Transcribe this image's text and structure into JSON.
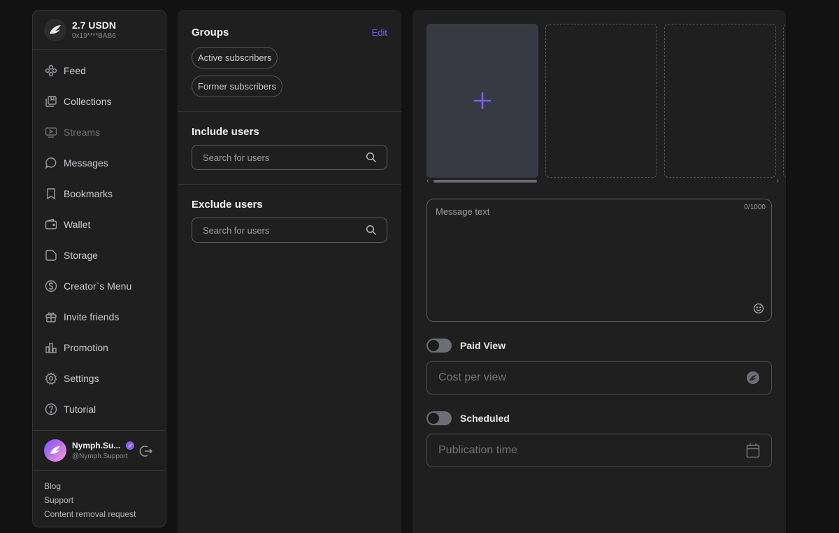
{
  "wallet": {
    "amount": "2.7 USDN",
    "address": "0x19****BAB6"
  },
  "nav": [
    {
      "label": "Feed",
      "icon": "feed-icon"
    },
    {
      "label": "Collections",
      "icon": "collections-icon"
    },
    {
      "label": "Streams",
      "icon": "streams-icon"
    },
    {
      "label": "Messages",
      "icon": "messages-icon"
    },
    {
      "label": "Bookmarks",
      "icon": "bookmark-icon"
    },
    {
      "label": "Wallet",
      "icon": "wallet-icon"
    },
    {
      "label": "Storage",
      "icon": "storage-icon"
    },
    {
      "label": "Creator`s Menu",
      "icon": "dollar-icon"
    },
    {
      "label": "Invite friends",
      "icon": "gift-icon"
    },
    {
      "label": "Promotion",
      "icon": "bar-chart-icon"
    },
    {
      "label": "Settings",
      "icon": "gear-icon"
    },
    {
      "label": "Tutorial",
      "icon": "question-icon"
    }
  ],
  "user": {
    "name": "Nymph.Su...",
    "handle": "@Nymph.Support"
  },
  "footer": {
    "blog": "Blog",
    "support": "Support",
    "content_removal": "Content removal request"
  },
  "groups": {
    "title": "Groups",
    "edit": "Edit",
    "chips": [
      "Active subscribers",
      "Former subscribers"
    ]
  },
  "include": {
    "title": "Include users",
    "placeholder": "Search for users"
  },
  "exclude": {
    "title": "Exclude users",
    "placeholder": "Search for users"
  },
  "composer": {
    "message_placeholder": "Message text",
    "counter": "0/1000",
    "paid_view_label": "Paid View",
    "cost_placeholder": "Cost per view",
    "scheduled_label": "Scheduled",
    "publication_placeholder": "Publication time"
  },
  "colors": {
    "accent": "#7c5cff",
    "panel": "#1f1f1f",
    "background": "#121212"
  }
}
